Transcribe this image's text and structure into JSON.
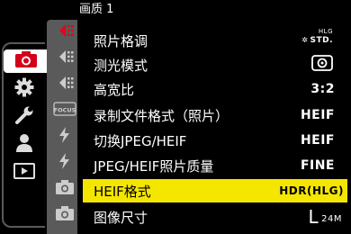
{
  "menu": {
    "title": "画质 1"
  },
  "categories": [
    {
      "name": "camera-icon",
      "active": true
    },
    {
      "name": "gear-icon",
      "active": false
    },
    {
      "name": "wrench-icon",
      "active": false
    },
    {
      "name": "person-icon",
      "active": false
    },
    {
      "name": "playback-icon",
      "active": false
    }
  ],
  "subpages": [
    {
      "name": "image-quality-page-icon",
      "active": true
    },
    {
      "name": "focus-shutter-page-icon",
      "label": "FOCUS"
    },
    {
      "name": "flash-page-icon"
    },
    {
      "name": "camera-page-icon"
    }
  ],
  "rows": [
    {
      "label": "照片格调",
      "value_icon": "photo-style-std-hlg-icon",
      "value_text": "STD.",
      "value_sup": "HLG"
    },
    {
      "label": "测光模式",
      "value_icon": "metering-multi-icon"
    },
    {
      "label": "高宽比",
      "value": "3:2"
    },
    {
      "label": "录制文件格式（照片）",
      "value": "HEIF"
    },
    {
      "label": "切换JPEG/HEIF",
      "value": "HEIF"
    },
    {
      "label": "JPEG/HEIF照片质量",
      "value": "FINE"
    },
    {
      "label": "HEIF格式",
      "value": "HDR(HLG)",
      "selected": true
    },
    {
      "label": "图像尺寸",
      "value_big": "L",
      "value_small": "24M"
    }
  ],
  "colors": {
    "accent_active": "#d4001a",
    "selection": "#f5e600",
    "rail": "#5a5a5a"
  }
}
